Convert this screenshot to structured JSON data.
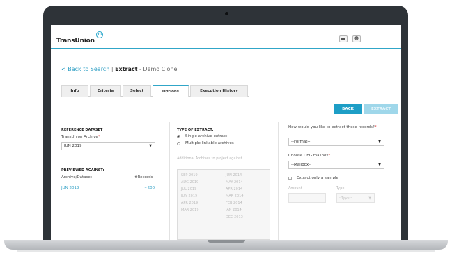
{
  "brand": {
    "name": "TransUnion",
    "badge": "TU"
  },
  "header_icons": [
    "grid-icon",
    "user-icon"
  ],
  "breadcrumb": {
    "back": "< Back to Search",
    "separator": " | ",
    "section": "Extract",
    "suffix": " - Demo Clone"
  },
  "tabs": [
    {
      "label": "Info"
    },
    {
      "label": "Criteria"
    },
    {
      "label": "Select"
    },
    {
      "label": "Options",
      "active": true
    },
    {
      "label": "Execution History"
    }
  ],
  "actions": {
    "back": "BACK",
    "extract": "EXTRACT"
  },
  "reference": {
    "title": "REFERENCE DATASET",
    "archive_label": "TransUnion Archive",
    "archive_value": "JUN 2019",
    "previewed_title": "PREVIEWED AGAINST:",
    "col_dataset": "Archive/Dataset",
    "col_records": "#Records",
    "row_dataset": "JUN 2019",
    "row_records": "~600"
  },
  "extract_type": {
    "title": "TYPE OF EXTRACT:",
    "options": [
      "Single archive extract",
      "Multiple linkable archives"
    ],
    "selected": 0,
    "additional_label": "Additional Archives to project against",
    "archives_left": [
      "SEP 2019",
      "AUG 2019",
      "JUL 2019",
      "JUN 2019",
      "APR 2019",
      "MAR 2019"
    ],
    "archives_right": [
      "JUN 2014",
      "MAY 2014",
      "APR 2014",
      "MAR 2014",
      "FEB 2014",
      "JAN 2014",
      "DEC 2013"
    ]
  },
  "output": {
    "format_question": "How would you like to extract these records?",
    "format_value": "--Format--",
    "mailbox_label": "Choose DEG mailbox",
    "mailbox_value": "--Mailbox--",
    "sample_label": "Extract only a sample",
    "amount_label": "Amount",
    "type_label": "Type",
    "type_value": "--Type--"
  },
  "colors": {
    "accent": "#1d9ec6",
    "accent_disabled": "#9fd7ea",
    "required": "#dd3333"
  }
}
